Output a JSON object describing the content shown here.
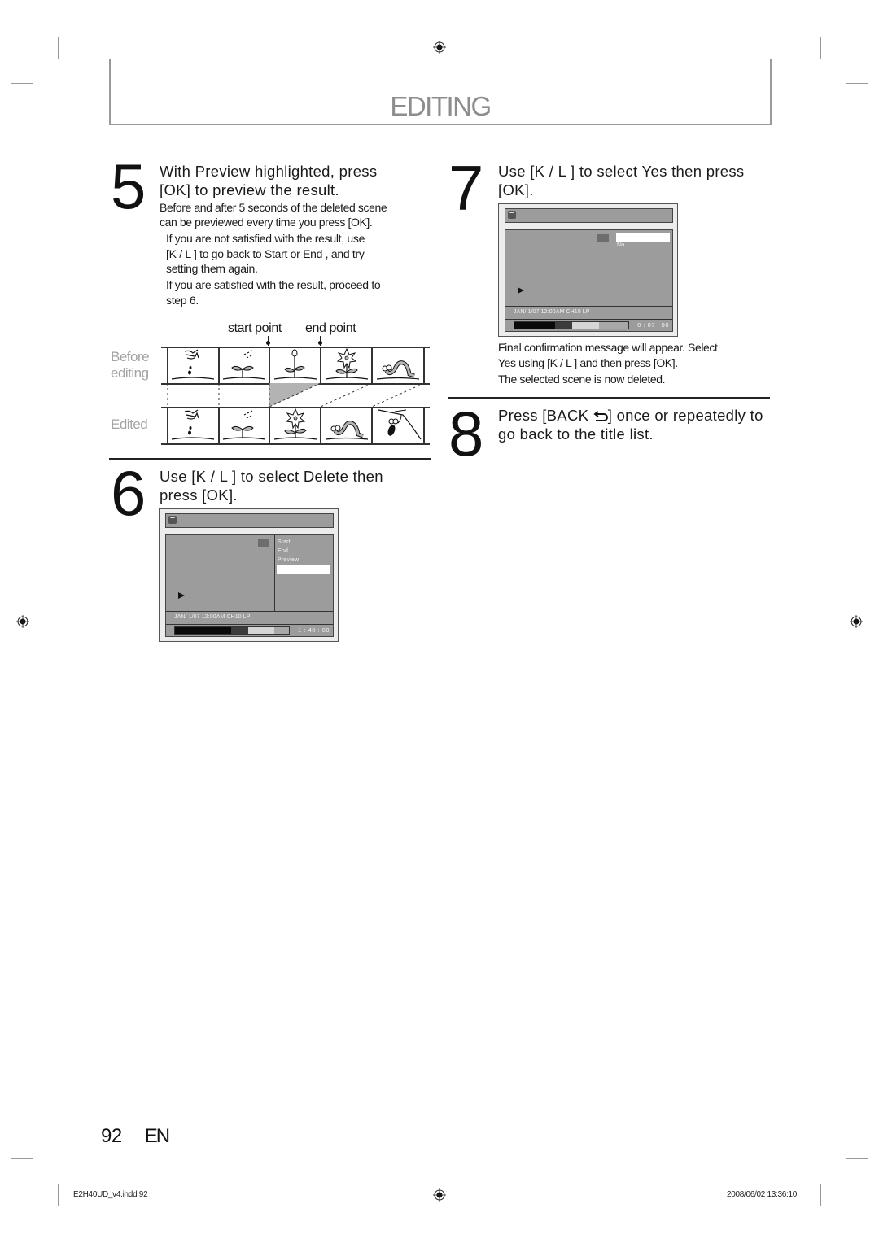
{
  "header": {
    "title": "EDITING"
  },
  "step5": {
    "number": "5",
    "heading_line1": "With  Preview  highlighted, press",
    "heading_line2": "[OK] to preview the result.",
    "body_line1": "Before and after 5 seconds of the deleted scene",
    "body_line2": "can be previewed every time you press [OK].",
    "bullet1_line1": "If you are not satisfied with the result, use",
    "bullet1_line2": "[K / L ] to go back to  Start  or  End , and try",
    "bullet1_line3": "setting them again.",
    "bullet2_line1": "If you are satisfied with the result, proceed to",
    "bullet2_line2": "step 6."
  },
  "diagram": {
    "start_label": "start point",
    "end_label": "end point",
    "before_label_line1": "Before",
    "before_label_line2": "editing",
    "edited_label": "Edited",
    "before_frames": [
      "hand-seed-icon",
      "sprout-icon",
      "tulip-icon",
      "flower-icon",
      "worm-icon"
    ],
    "edited_frames": [
      "hand-seed-icon",
      "sprout-icon",
      "flower-icon",
      "worm-icon",
      "bird-icon"
    ]
  },
  "step6": {
    "number": "6",
    "heading_line1": "Use [K / L ] to select  Delete  then",
    "heading_line2": "press [OK].",
    "screen": {
      "menu_items": [
        "Start",
        "End",
        "Preview",
        ""
      ],
      "selected_index": 3,
      "info": "JAN/ 1/07 12:00AM CH10   LP",
      "time": "1 : 40 : 00",
      "progress": {
        "played": 0.49,
        "marked_end": 0.64,
        "buffered_end": 0.87
      }
    }
  },
  "step7": {
    "number": "7",
    "heading_line1": "Use [K / L ] to select  Yes  then press",
    "heading_line2": "[OK].",
    "screen": {
      "menu_items": [
        "",
        "No"
      ],
      "selected_index": 0,
      "info": "JAN/ 1/07 12:00AM CH10   LP",
      "time": "0 : 07 : 00",
      "progress": {
        "played": 0.36,
        "marked_end": 0.51,
        "buffered_end": 0.74
      }
    },
    "body_line1": "Final confirmation message will appear. Select",
    "body_line2": " Yes  using [K / L ] and then press [OK].",
    "body_line3": "The selected scene is now deleted."
  },
  "step8": {
    "number": "8",
    "heading_line1_pre": "Press [BACK ",
    "heading_line1_post": "] once or repeatedly to",
    "heading_line2": "go back to the title list."
  },
  "footer": {
    "page_number": "92",
    "language": "EN",
    "slug_file": "E2H40UD_v4.indd   92",
    "slug_date": "2008/06/02   13:36:10"
  }
}
